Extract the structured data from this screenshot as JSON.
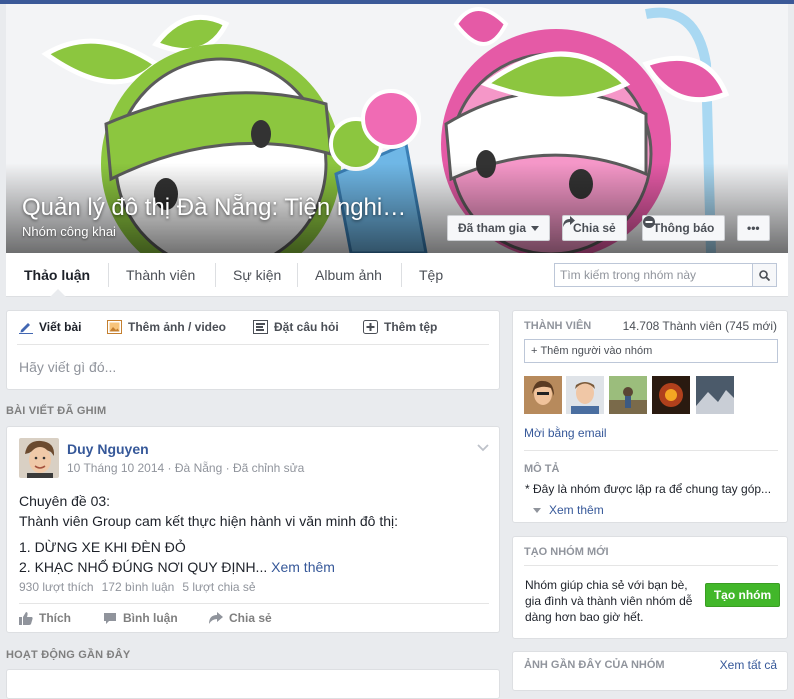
{
  "group": {
    "title": "Quản lý đô thị Đà Nẵng: Tiện nghi…",
    "privacy": "Nhóm công khai"
  },
  "cover_actions": {
    "joined": "Đã tham gia",
    "share": "Chia sẻ",
    "notifications": "Thông báo",
    "more": "•••"
  },
  "tabs": [
    {
      "label": "Thảo luận",
      "active": true
    },
    {
      "label": "Thành viên"
    },
    {
      "label": "Sự kiện"
    },
    {
      "label": "Album ảnh"
    },
    {
      "label": "Tệp"
    }
  ],
  "search": {
    "placeholder": "Tìm kiếm trong nhóm này"
  },
  "composer": {
    "tabs": [
      "Viết bài",
      "Thêm ảnh / video",
      "Đặt câu hỏi",
      "Thêm tệp"
    ],
    "placeholder": "Hãy viết gì đó..."
  },
  "pinned_label": "BÀI VIẾT ĐÃ GHIM",
  "post": {
    "author": "Duy Nguyen",
    "date": "10 Tháng 10 2014",
    "location": "Đà Nẵng",
    "edited": "Đã chỉnh sửa",
    "line1": "Chuyên đề 03:",
    "line2": "Thành viên Group cam kết thực hiện hành vi văn minh đô thị:",
    "line3": "1. DỪNG XE KHI ĐÈN ĐỎ",
    "line4": "2. KHẠC NHỔ ĐÚNG NƠI QUY ĐỊNH...",
    "see_more": "Xem thêm",
    "likes": "930 lượt thích",
    "comments": "172 bình luận",
    "shares": "5 lượt chia sẻ",
    "actions": [
      "Thích",
      "Bình luận",
      "Chia sẻ"
    ]
  },
  "recent_label": "HOẠT ĐỘNG GẦN ĐÂY",
  "members": {
    "label": "THÀNH VIÊN",
    "count": "14.708 Thành viên (745 mới)",
    "add_placeholder": "Thêm người vào nhóm",
    "invite_email": "Mời bằng email",
    "desc_label": "MÔ TẢ",
    "desc_text": "* Đây là nhóm được lập ra để chung tay góp...",
    "see_more": "Xem thêm"
  },
  "create_group": {
    "label": "TẠO NHÓM MỚI",
    "text": "Nhóm giúp chia sẻ với bạn bè, gia đình và thành viên nhóm dễ dàng hơn bao giờ hết.",
    "button": "Tạo nhóm"
  },
  "photos": {
    "label": "ẢNH GẦN ĐÂY CỦA NHÓM",
    "see_all": "Xem tất cả"
  },
  "colors": {
    "facebook_blue": "#3b5998",
    "link": "#365899",
    "create_green": "#42b72a",
    "mascot_green": "#8cc63f",
    "mascot_pink": "#e55aa6"
  }
}
